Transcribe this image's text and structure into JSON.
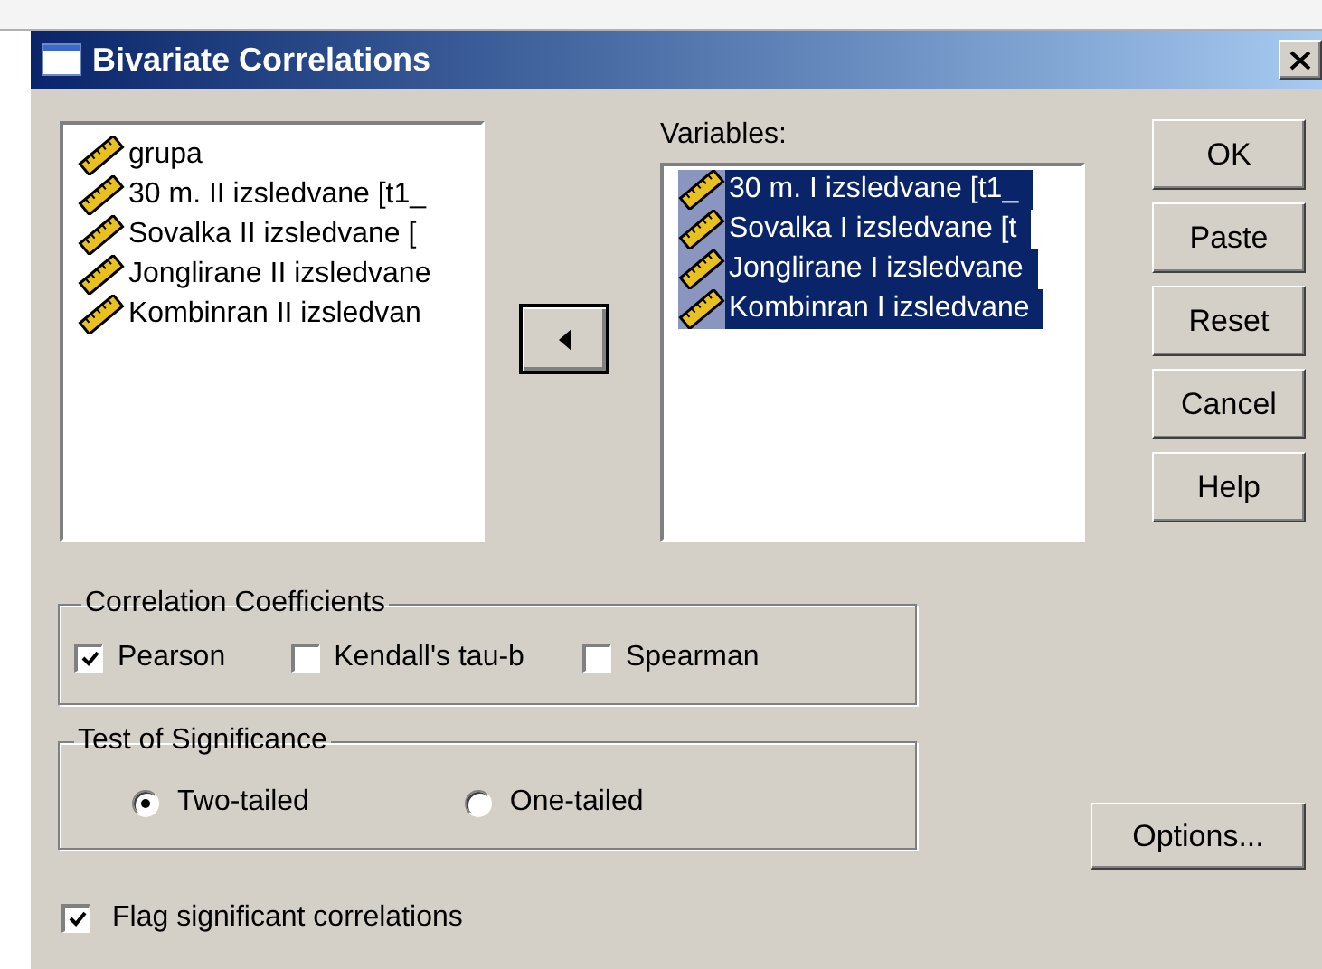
{
  "window": {
    "title": "Bivariate Correlations"
  },
  "source_list": {
    "items": [
      {
        "label": "grupa",
        "selected": false
      },
      {
        "label": "30 m. II izsledvane [t1_",
        "selected": false
      },
      {
        "label": "Sovalka II izsledvane [",
        "selected": false
      },
      {
        "label": "Jonglirane II izsledvane",
        "selected": false
      },
      {
        "label": "Kombinran II izsledvan",
        "selected": false
      }
    ]
  },
  "variables": {
    "label": "Variables:",
    "items": [
      {
        "label": "30 m. I izsledvane [t1_",
        "selected": true
      },
      {
        "label": "Sovalka I izsledvane [t",
        "selected": true
      },
      {
        "label": "Jonglirane I izsledvane",
        "selected": true
      },
      {
        "label": "Kombinran I izsledvane",
        "selected": true
      }
    ]
  },
  "buttons": [
    "OK",
    "Paste",
    "Reset",
    "Cancel",
    "Help"
  ],
  "correlation_coefficients": {
    "title": "Correlation Coefficients",
    "options": [
      {
        "label": "Pearson",
        "checked": true
      },
      {
        "label": "Kendall's tau-b",
        "checked": false
      },
      {
        "label": "Spearman",
        "checked": false
      }
    ]
  },
  "test_of_significance": {
    "title": "Test of Significance",
    "options": [
      {
        "label": "Two-tailed",
        "selected": true
      },
      {
        "label": "One-tailed",
        "selected": false
      }
    ]
  },
  "flag": {
    "label": "Flag significant correlations",
    "checked": true
  },
  "options_button": "Options..."
}
